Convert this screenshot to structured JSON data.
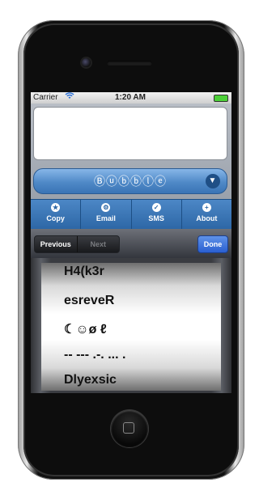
{
  "status_bar": {
    "carrier": "Carrier",
    "wifi_icon": "wifi-icon",
    "time": "1:20 AM",
    "battery_color": "#4cd038"
  },
  "editor": {
    "text": "",
    "bubble_label": "Ⓑⓤⓑⓑⓛⓔ"
  },
  "tabs": [
    {
      "label": "Copy",
      "icon": "star-icon"
    },
    {
      "label": "Email",
      "icon": "gear-icon"
    },
    {
      "label": "SMS",
      "icon": "check-icon"
    },
    {
      "label": "About",
      "icon": "plus-icon"
    }
  ],
  "accessory": {
    "previous": "Previous",
    "next": "Next",
    "done": "Done"
  },
  "picker": {
    "rows": [
      "H4(k3r",
      "esreveR",
      "☾☺ø ℓ",
      "-- --- .-. ... .",
      "Dlyexsic"
    ]
  },
  "colors": {
    "accent_blue": "#3a74b5",
    "done_blue": "#2a5fd1"
  }
}
